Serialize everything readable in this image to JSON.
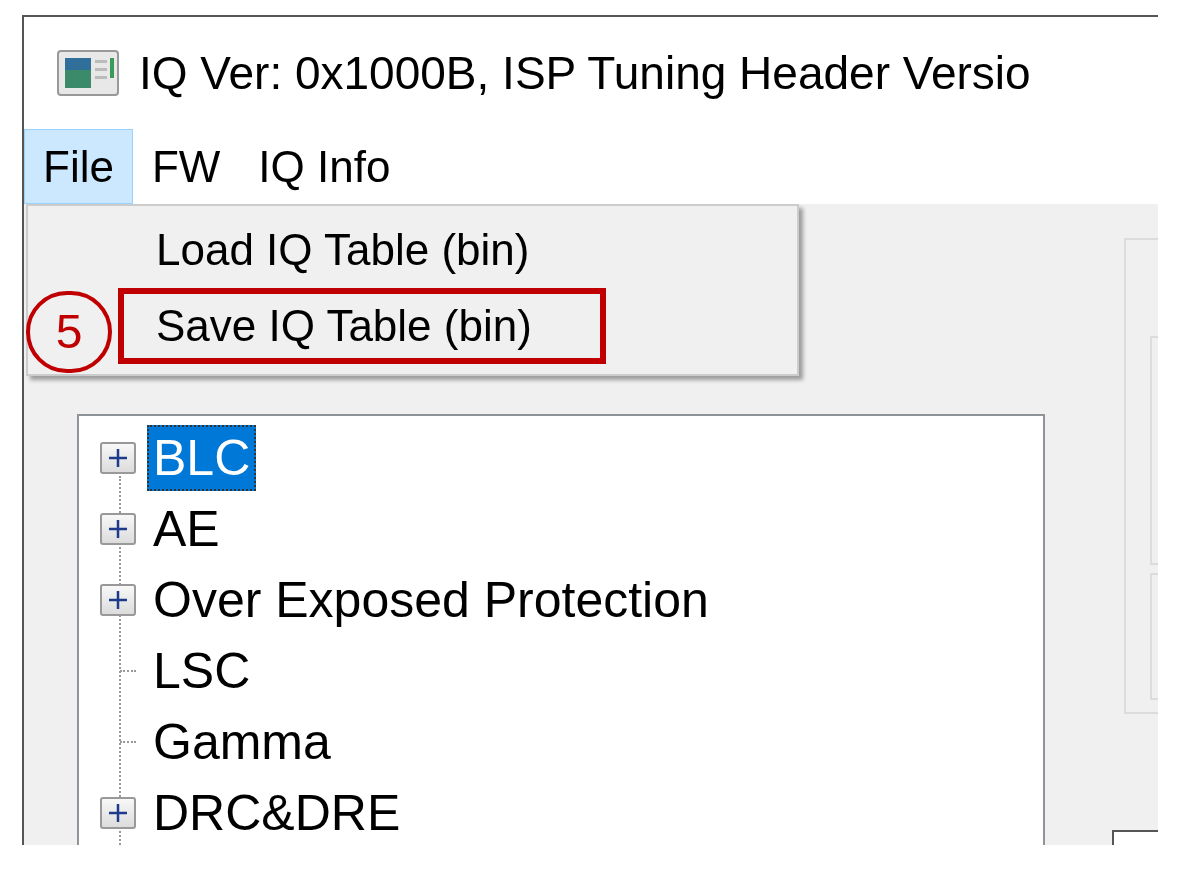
{
  "window": {
    "title": "IQ Ver: 0x1000B, ISP Tuning Header Versio"
  },
  "menu_bar": [
    {
      "label": "File",
      "selected": true
    },
    {
      "label": "FW",
      "selected": false
    },
    {
      "label": "IQ Info",
      "selected": false
    }
  ],
  "dropdown": {
    "items": [
      {
        "label": "Load IQ Table (bin)",
        "highlighted": false
      },
      {
        "label": "Save IQ Table (bin)",
        "highlighted": true
      }
    ]
  },
  "annotation": {
    "number": "5"
  },
  "tree": {
    "items": [
      {
        "label": "BLC",
        "kind": "branch",
        "expanded": false,
        "selected": true
      },
      {
        "label": "AE",
        "kind": "branch",
        "expanded": false,
        "selected": false
      },
      {
        "label": "Over Exposed Protection",
        "kind": "branch",
        "expanded": false,
        "selected": false
      },
      {
        "label": "LSC",
        "kind": "leaf",
        "selected": false
      },
      {
        "label": "Gamma",
        "kind": "leaf",
        "selected": false
      },
      {
        "label": "DRC&DRE",
        "kind": "branch",
        "expanded": false,
        "selected": false
      }
    ]
  }
}
